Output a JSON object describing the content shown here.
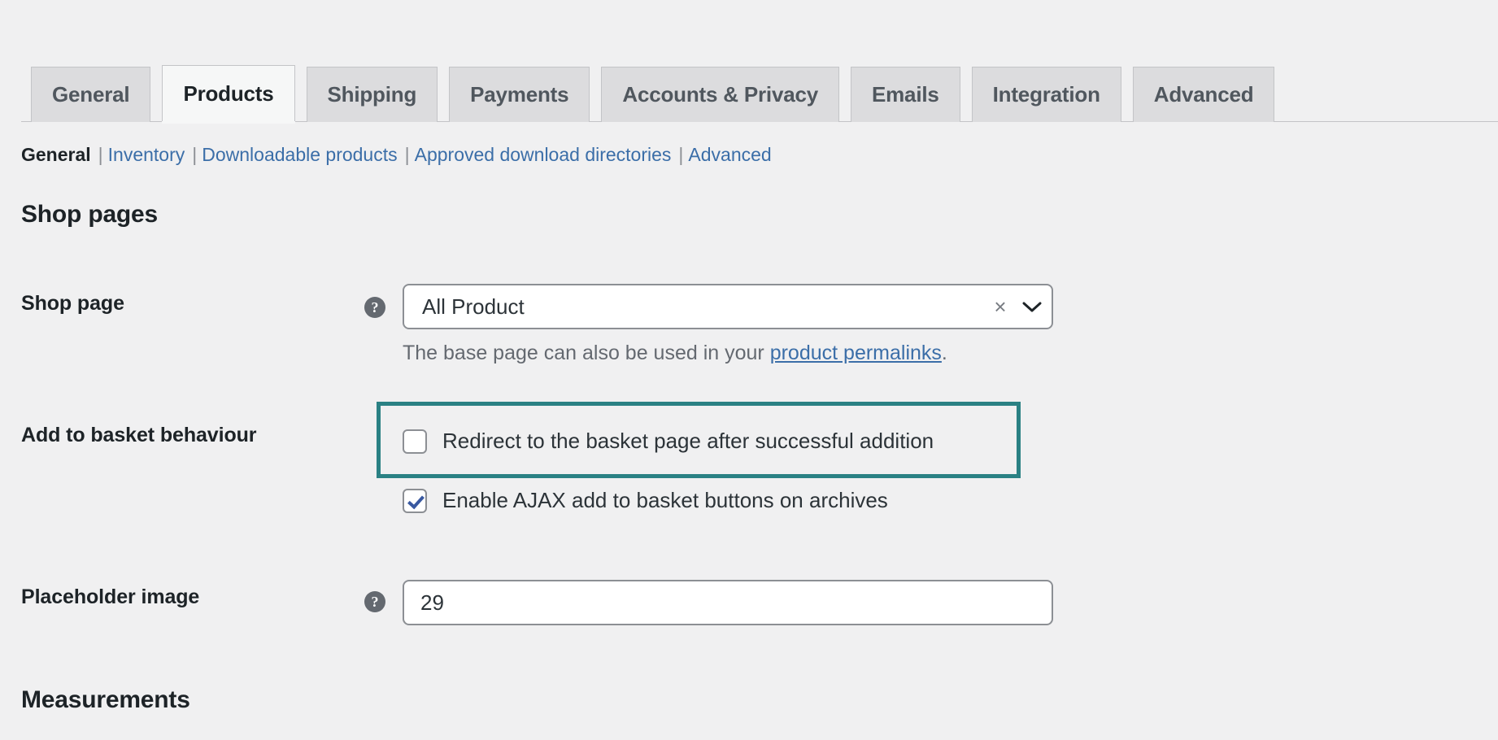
{
  "tabs": [
    {
      "label": "General",
      "active": false
    },
    {
      "label": "Products",
      "active": true
    },
    {
      "label": "Shipping",
      "active": false
    },
    {
      "label": "Payments",
      "active": false
    },
    {
      "label": "Accounts & Privacy",
      "active": false
    },
    {
      "label": "Emails",
      "active": false
    },
    {
      "label": "Integration",
      "active": false
    },
    {
      "label": "Advanced",
      "active": false
    }
  ],
  "subnav": {
    "current": "General",
    "links": [
      "Inventory",
      "Downloadable products",
      "Approved download directories",
      "Advanced"
    ],
    "separator": "|"
  },
  "sections": {
    "shop_pages_title": "Shop pages",
    "measurements_title": "Measurements"
  },
  "shop_page": {
    "label": "Shop page",
    "help_glyph": "?",
    "selected_value": "All Product",
    "clear_glyph": "×",
    "description_before": "The base page can also be used in your ",
    "description_link": "product permalinks",
    "description_after": "."
  },
  "add_to_basket": {
    "label": "Add to basket behaviour",
    "options": [
      {
        "label": "Redirect to the basket page after successful addition",
        "checked": false,
        "highlighted": true
      },
      {
        "label": "Enable AJAX add to basket buttons on archives",
        "checked": true,
        "highlighted": false
      }
    ]
  },
  "placeholder_image": {
    "label": "Placeholder image",
    "help_glyph": "?",
    "value": "29",
    "placeholder": ""
  },
  "colors": {
    "page_background": "#f0f0f1",
    "tab_inactive_background": "#dcdcde",
    "tab_active_background": "#f6f7f7",
    "border": "#c3c4c7",
    "link": "#3b6ea8",
    "highlight_outline": "#2a8184",
    "checkbox_check": "#3858a0",
    "muted_text": "#646970",
    "heading_text": "#1d2327"
  }
}
